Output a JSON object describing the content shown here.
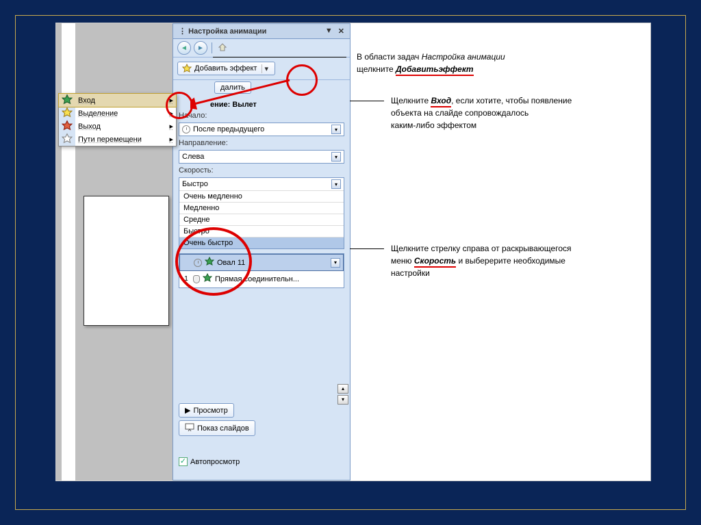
{
  "pane": {
    "title": "Настройка анимации",
    "add_effect": "Добавить эффект",
    "delete_partial": "далить",
    "change_label_partial": "ение: Вылет",
    "start_label": "Начало:",
    "start_value": "После предыдущего",
    "direction_label": "Направление:",
    "direction_value": "Слева",
    "speed_label": "Скорость:",
    "speed_open": "Быстро",
    "speed_options": [
      "Очень медленно",
      "Медленно",
      "Средне",
      "Быстро",
      "Очень быстро"
    ],
    "effect1": "Овал 11",
    "effect2_num": "1",
    "effect2_label": "Прямая соединительн...",
    "preview": "Просмотр",
    "slideshow": "Показ слайдов",
    "autopreview": "Автопросмотр"
  },
  "menu": {
    "items": [
      {
        "label": "Вход",
        "selected": true,
        "color": "#2a9e4a"
      },
      {
        "label": "Выделение",
        "selected": false,
        "color": "#e0c030"
      },
      {
        "label": "Выход",
        "selected": false,
        "color": "#d04020"
      },
      {
        "label": "Пути перемещени",
        "selected": false,
        "color": "#888888"
      }
    ]
  },
  "annot": {
    "a1_pre": "В области задач ",
    "a1_ital": "Настройка анимации",
    "a1_post": " щелкните ",
    "a1_link": "Добавитьэффект",
    "a2_pre": "Щелкните ",
    "a2_link": "Вход",
    "a2_post1": ", если хотите, чтобы появление",
    "a2_line2": "объекта на слайде сопровождалось",
    "a2_line3": "каким-либо эффектом",
    "a3_line1a": "Щелкните стрелку справа от раскрывающегося",
    "a3_line2a": "меню ",
    "a3_link": "Скорость",
    "a3_line2b": " и выберерите необходимые",
    "a3_line3": "настройки"
  }
}
